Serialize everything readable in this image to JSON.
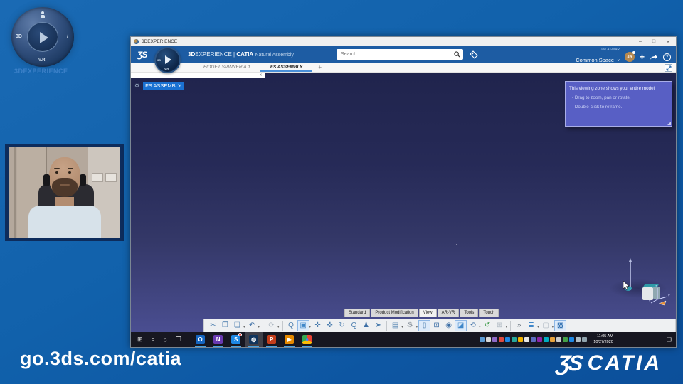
{
  "colors": {
    "accent_blue": "#4a90d9",
    "bar_blue": "#1d5ca3",
    "selection_blue": "#1a71d2",
    "viewport_top": "#20244d",
    "viewport_bottom": "#4a4e91",
    "tooltip_bg": "#5c64cd",
    "taskbar_bg": "#171721"
  },
  "overlay": {
    "url": "go.3ds.com/catia",
    "brand_caption": "3DEXPERIENCE",
    "catia_mark": "ƷS",
    "catia_name": "CATIA",
    "compass": {
      "left": "3D",
      "bottom": "V.R",
      "right": "I"
    }
  },
  "titlebar": {
    "title": "3DEXPERIENCE",
    "minimize": "–",
    "maximize": "□",
    "close": "✕"
  },
  "topbar": {
    "ds_mark": "ƷS",
    "brand_bold": "3D",
    "brand_light": "EXPERIENCE",
    "divider": "|",
    "app_name": "CATIA",
    "app_edition": "Natural Assembly",
    "search_placeholder": "Search",
    "user_name": "Joe ASMAR",
    "space_label": "Common Space",
    "space_caret": "˅",
    "avatar_initials": "JA",
    "plus": "+",
    "help": "?",
    "compass_vr": "V.R",
    "compass_3d": "3D"
  },
  "tabs": [
    {
      "label": "FIDGET SPINNER A.1",
      "active": false
    },
    {
      "label": "FS ASSEMBLY",
      "active": true
    }
  ],
  "new_tab": "+",
  "tree": {
    "icon": "⚙",
    "root": "FS ASSEMBLY",
    "collapse": "‹"
  },
  "tooltip": {
    "line1": "This viewing zone shows your entire model",
    "line2": "- Drag to zoom, pan or rotate.",
    "line3": "- Double-click to reframe."
  },
  "viewport_axes": {
    "x": "x",
    "y": "y",
    "z": "z"
  },
  "ribbon": {
    "tabs": [
      {
        "label": "Standard"
      },
      {
        "label": "Product Modification"
      },
      {
        "label": "View",
        "active": true
      },
      {
        "label": "AR-VR"
      },
      {
        "label": "Tools"
      },
      {
        "label": "Touch"
      }
    ]
  },
  "toolbar": {
    "icons": [
      {
        "name": "cut-icon",
        "glyph": "✂",
        "color": "#4b7dae"
      },
      {
        "name": "copy-icon",
        "glyph": "❐",
        "color": "#4b7dae"
      },
      {
        "name": "paste-icon",
        "glyph": "❏",
        "color": "#4b7dae",
        "caret": true
      },
      {
        "name": "undo-icon",
        "glyph": "↶",
        "color": "#3c6ea5",
        "caret": true
      },
      {
        "sep": true
      },
      {
        "name": "update-icon",
        "glyph": "⟳",
        "color": "#aeb8c2",
        "caret": true
      },
      {
        "sep": true
      },
      {
        "name": "reframe-zoom-icon",
        "glyph": "Q",
        "color": "#4b7dae"
      },
      {
        "name": "view-cube-icon",
        "glyph": "▣",
        "color": "#3f86c8",
        "selected": true,
        "caret": true
      },
      {
        "name": "fit-all-icon",
        "glyph": "✛",
        "color": "#4b7dae"
      },
      {
        "name": "pan-icon",
        "glyph": "✜",
        "color": "#4b7dae"
      },
      {
        "name": "rotate-icon",
        "glyph": "↻",
        "color": "#4b7dae"
      },
      {
        "name": "zoom-icon",
        "glyph": "Q",
        "color": "#4b7dae"
      },
      {
        "name": "walk-icon",
        "glyph": "♟",
        "color": "#3c6ea5"
      },
      {
        "name": "fly-icon",
        "glyph": "➤",
        "color": "#4b7dae"
      },
      {
        "sep": true
      },
      {
        "name": "iso-view-icon",
        "glyph": "▤",
        "color": "#4b7dae",
        "caret": true
      },
      {
        "name": "render-style-icon",
        "glyph": "⚙",
        "color": "#8a949e",
        "caret": true
      },
      {
        "name": "section-icon",
        "glyph": "▯",
        "color": "#4b7dae",
        "selected": true
      },
      {
        "name": "screen-icon",
        "glyph": "⊡",
        "color": "#3c6ea5"
      },
      {
        "name": "hide-show-icon",
        "glyph": "◉",
        "color": "#3c6ea5"
      },
      {
        "name": "visible-space-icon",
        "glyph": "◪",
        "color": "#3f86c8",
        "selected": true
      },
      {
        "name": "rotate-view-icon",
        "glyph": "⟲",
        "color": "#3c6ea5",
        "caret": true
      },
      {
        "name": "turntable-icon",
        "glyph": "↺",
        "color": "#3a9a46"
      },
      {
        "name": "quad-view-icon",
        "glyph": "⊞",
        "color": "#aeb8c2",
        "caret": true
      },
      {
        "sep": true
      },
      {
        "name": "overflow-icon",
        "glyph": "»",
        "color": "#6a7680"
      },
      {
        "name": "design-tree-icon",
        "glyph": "≣",
        "color": "#3f86c8",
        "caret": true
      },
      {
        "name": "ghost-mode-icon",
        "glyph": "▢",
        "color": "#aeb8c2",
        "caret": true
      },
      {
        "name": "fullscreen-icon",
        "glyph": "▩",
        "color": "#2f6fb0",
        "selected": true
      }
    ]
  },
  "taskbar": {
    "system": [
      {
        "name": "start-icon",
        "glyph": "⊞"
      },
      {
        "name": "search-icon",
        "glyph": "⌕"
      },
      {
        "name": "cortana-icon",
        "glyph": "○"
      },
      {
        "name": "task-view-icon",
        "glyph": "❒"
      }
    ],
    "apps": [
      {
        "name": "taskbar-app-outlook",
        "bg": "#1565c0",
        "glyph": "O"
      },
      {
        "name": "taskbar-app-onenote",
        "bg": "#6a3ab2",
        "glyph": "N"
      },
      {
        "name": "taskbar-app-skype",
        "bg": "#1e88e5",
        "glyph": "S",
        "badge": true
      },
      {
        "name": "taskbar-app-3dexperience",
        "bg": "#10355e",
        "glyph": "◍",
        "active": true
      },
      {
        "name": "taskbar-app-powerpoint",
        "bg": "#c43e1c",
        "glyph": "P"
      },
      {
        "name": "taskbar-app-stream",
        "bg": "#e68a00",
        "glyph": "▶"
      },
      {
        "name": "taskbar-app-chrome",
        "bg": "conic-gradient(#ea4335 0deg 120deg,#fbbc05 120deg 240deg,#34a853 240deg 360deg)",
        "glyph": "●",
        "fg": "#4285f4"
      }
    ],
    "tray": [
      "#5b9bd5",
      "#d9d9d9",
      "#8e6ac8",
      "#e04a3f",
      "#1e88e5",
      "#26a69a",
      "#f4b400",
      "#e8e8e8",
      "#5c6bc0",
      "#8e24aa",
      "#00acc1",
      "#e8a33d",
      "#cccccc",
      "#43a047",
      "#1e88e5",
      "#b0bec5",
      "#90a4ae"
    ],
    "time": "11:05 AM",
    "date": "10/27/2020",
    "notification_glyph": "❏"
  }
}
